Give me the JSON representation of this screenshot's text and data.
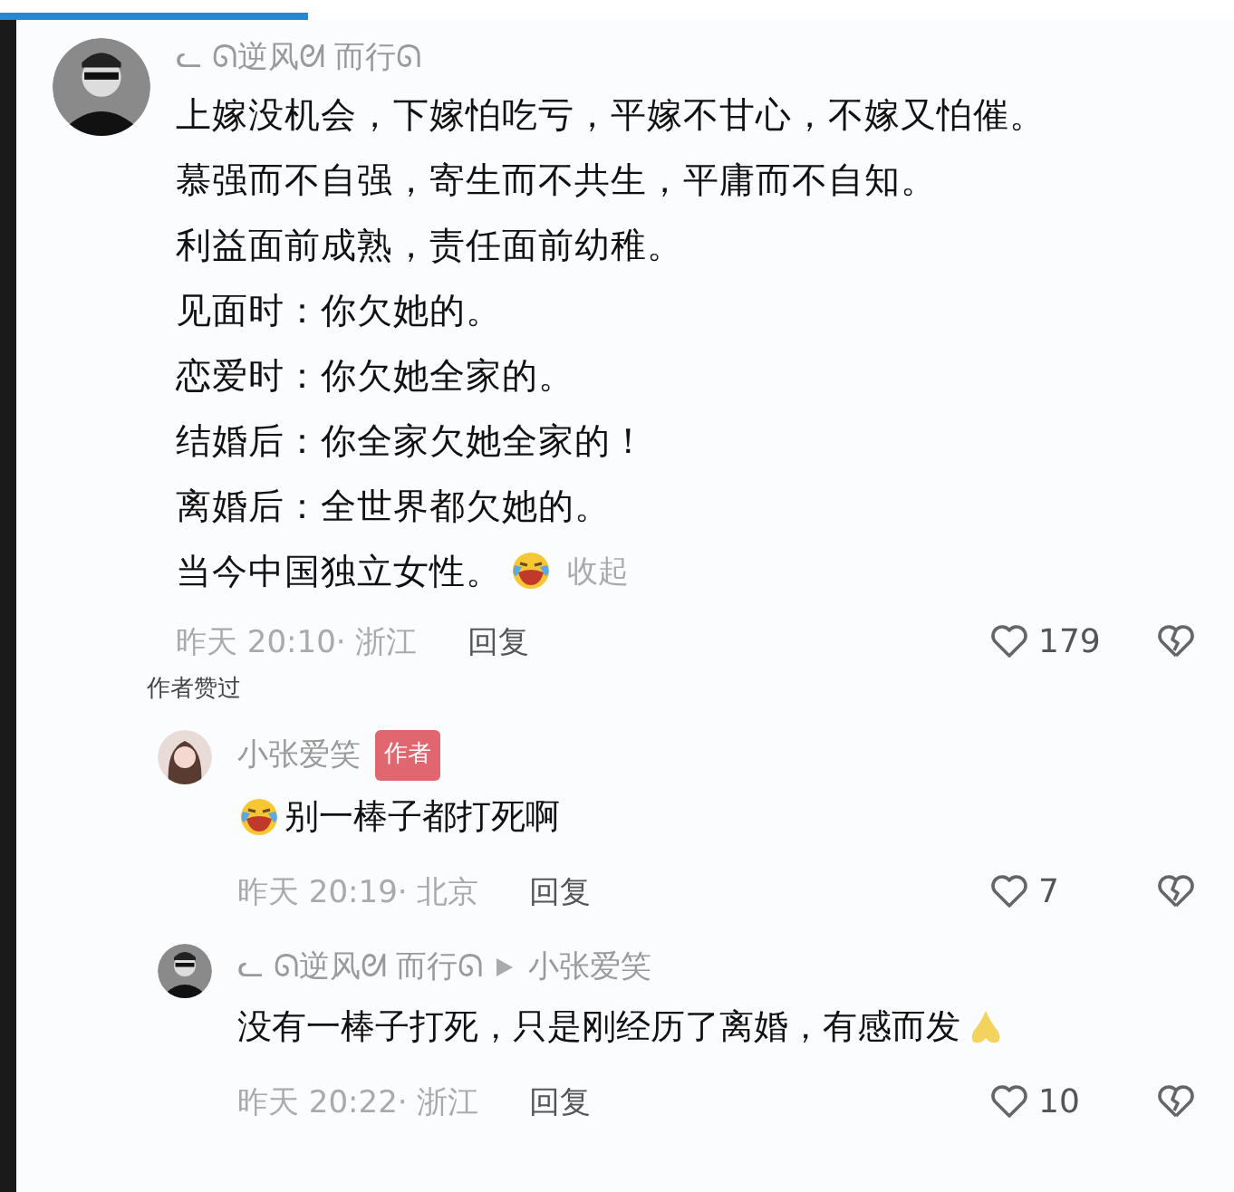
{
  "progress": {
    "level": 0.25
  },
  "comment": {
    "author": "ᓚ ᘏ逆风ᘛ 而行ᘏ",
    "lines": [
      [
        {
          "kind": "text",
          "text": "上嫁没机会，下嫁怕吃亏，平嫁不甘心，不嫁又怕催。"
        }
      ],
      [
        {
          "kind": "text",
          "text": "慕强而不自强，寄生而不共生，平庸而不自知。"
        }
      ],
      [
        {
          "kind": "text",
          "text": "利益面前成熟，责任面前幼稚。"
        }
      ],
      [
        {
          "kind": "text",
          "text": "见面时：你欠她的。"
        }
      ],
      [
        {
          "kind": "text",
          "text": "恋爱时：你欠她全家的。"
        }
      ],
      [
        {
          "kind": "text",
          "text": "结婚后：你全家欠她全家的！"
        }
      ],
      [
        {
          "kind": "text",
          "text": "离婚后：全世界都欠她的。"
        }
      ],
      [
        {
          "kind": "text",
          "text": "当今中国独立女性。"
        },
        {
          "kind": "laugh-cry"
        }
      ]
    ],
    "collapse": "收起",
    "meta": "昨天 20:10· 浙江",
    "reply": "回复",
    "likes": "179",
    "author_liked": "作者赞过"
  },
  "replies": [
    {
      "author": "小张爱笑",
      "badge": "作者",
      "body": [
        {
          "kind": "laugh-cry"
        },
        {
          "kind": "text",
          "text": "别一棒子都打死啊"
        }
      ],
      "meta": "昨天 20:19· 北京",
      "reply": "回复",
      "likes": "7"
    },
    {
      "author": "ᓚ ᘏ逆风ᘛ 而行ᘏ",
      "reply_to": "小张爱笑",
      "body": [
        {
          "kind": "text",
          "text": "没有一棒子打死，只是刚经历了离婚，有感而发"
        },
        {
          "kind": "folded-hands"
        }
      ],
      "meta": "昨天 20:22· 浙江",
      "reply": "回复",
      "likes": "10"
    }
  ]
}
